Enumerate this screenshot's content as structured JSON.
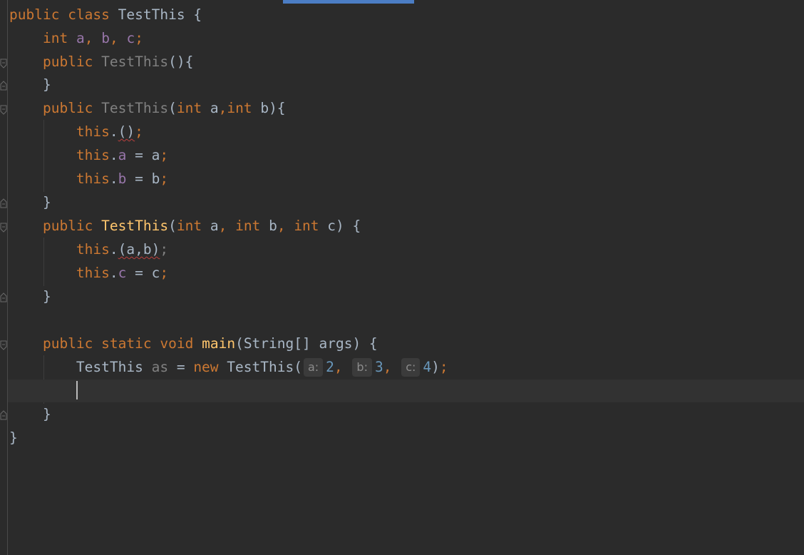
{
  "editor": {
    "lines": {
      "l1": [
        "public",
        "class",
        "TestThis",
        "{"
      ],
      "l2": [
        "int",
        "a",
        "b",
        "c"
      ],
      "l3": [
        "public",
        "TestThis",
        "(){"
      ],
      "l4": [
        "}"
      ],
      "l5": [
        "public",
        "TestThis",
        "int",
        "a",
        "int",
        "b"
      ],
      "l6": [
        "this",
        "()"
      ],
      "l7": [
        "this",
        "a",
        "a"
      ],
      "l8": [
        "this",
        "b",
        "b"
      ],
      "l9": [
        "}"
      ],
      "l10": [
        "public",
        "TestThis",
        "int",
        "a",
        "int",
        "b",
        "int",
        "c"
      ],
      "l11": [
        "this",
        "(a,b)"
      ],
      "l12": [
        "this",
        "c",
        "c"
      ],
      "l13": [
        "}"
      ],
      "l15": [
        "public",
        "static",
        "void",
        "main",
        "String[] args"
      ],
      "l16": [
        "TestThis",
        "as",
        "new",
        "TestThis"
      ],
      "l18": [
        "}"
      ],
      "l19": [
        "}"
      ]
    },
    "hints": {
      "a_label": "a:",
      "a_value": "2",
      "b_label": "b:",
      "b_value": "3",
      "c_label": "c:",
      "c_value": "4"
    },
    "colors": {
      "background": "#2b2b2b",
      "keyword": "#cc7832",
      "field": "#9876aa",
      "method": "#ffc66d",
      "number": "#6897bb",
      "text": "#a9b7c6",
      "current_line": "#323232",
      "scrollbar_thumb": "#4b7dc4"
    }
  }
}
